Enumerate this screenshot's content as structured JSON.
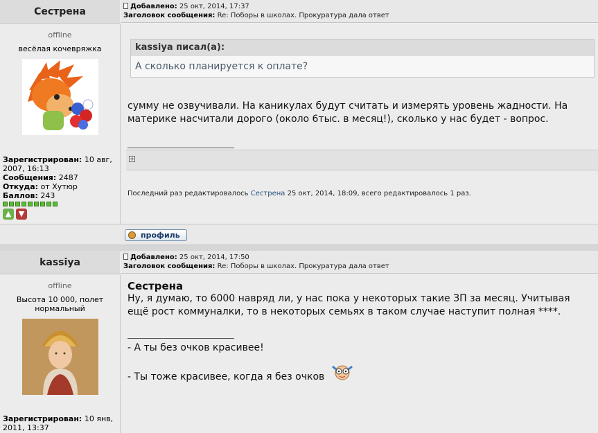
{
  "post1": {
    "author": "Сестрена",
    "status": "offline",
    "rank": "весёлая кочевряжка",
    "avatar_icon": "hedgehog-with-flowers-avatar",
    "registered_label": "Зарегистрирован:",
    "registered_value": "10 авг, 2007, 16:13",
    "messages_label": "Сообщения:",
    "messages_value": "2487",
    "from_label": "Откуда:",
    "from_value": "от Хутюр",
    "points_label": "Баллов:",
    "points_value": "243",
    "reputation_level": 9,
    "added_label": "Добавлено:",
    "added_value": "25 окт, 2014, 17:37",
    "subject_label": "Заголовок сообщения:",
    "subject_value": "Re: Поборы в школах. Прокуратура дала ответ",
    "quote_author": "kassiya писал(а):",
    "quote_text": "А сколько планируется к оплате?",
    "message": "сумму не озвучивали. На каникулах будут считать и измерять уровень жадности. На материке насчитали дорого (около 6тыс. в месяц!), сколько у нас будет - вопрос.",
    "signature_line": "_________________",
    "signature_toggle": "+",
    "edited_prefix": "Последний раз редактировалось",
    "edited_user": "Сестрена",
    "edited_suffix": "25 окт, 2014, 18:09, всего редактировалось 1 раз.",
    "profile_button": "профиль"
  },
  "post2": {
    "author": "kassiya",
    "status": "offline",
    "rank": "Высота 10 000, полет нормальный",
    "avatar_icon": "woman-in-kokoshnik-avatar",
    "registered_label": "Зарегистрирован:",
    "registered_value": "10 янв, 2011, 13:37",
    "added_label": "Добавлено:",
    "added_value": "25 окт, 2014, 17:50",
    "subject_label": "Заголовок сообщения:",
    "subject_value": "Re: Поборы в школах. Прокуратура дала ответ",
    "reply_to": "Сестрена",
    "message": "Ну, я думаю, то 6000 навряд ли, у нас пока у некоторых такие ЗП за месяц. Учитывая ещё рост коммуналки, то в некоторых семьях в таком случае наступит полная ****.",
    "signature_line": "_________________",
    "sig1": "- А ты без очков красивее!",
    "sig2": "- Ты тоже красивее, когда я без очков",
    "smiley_icon": "glasses-smiley-icon"
  },
  "colors": {
    "link": "#24507a",
    "reputation_bar": "#5fba3a",
    "rate_up": "#6ab04c",
    "rate_down": "#b43a3a"
  }
}
